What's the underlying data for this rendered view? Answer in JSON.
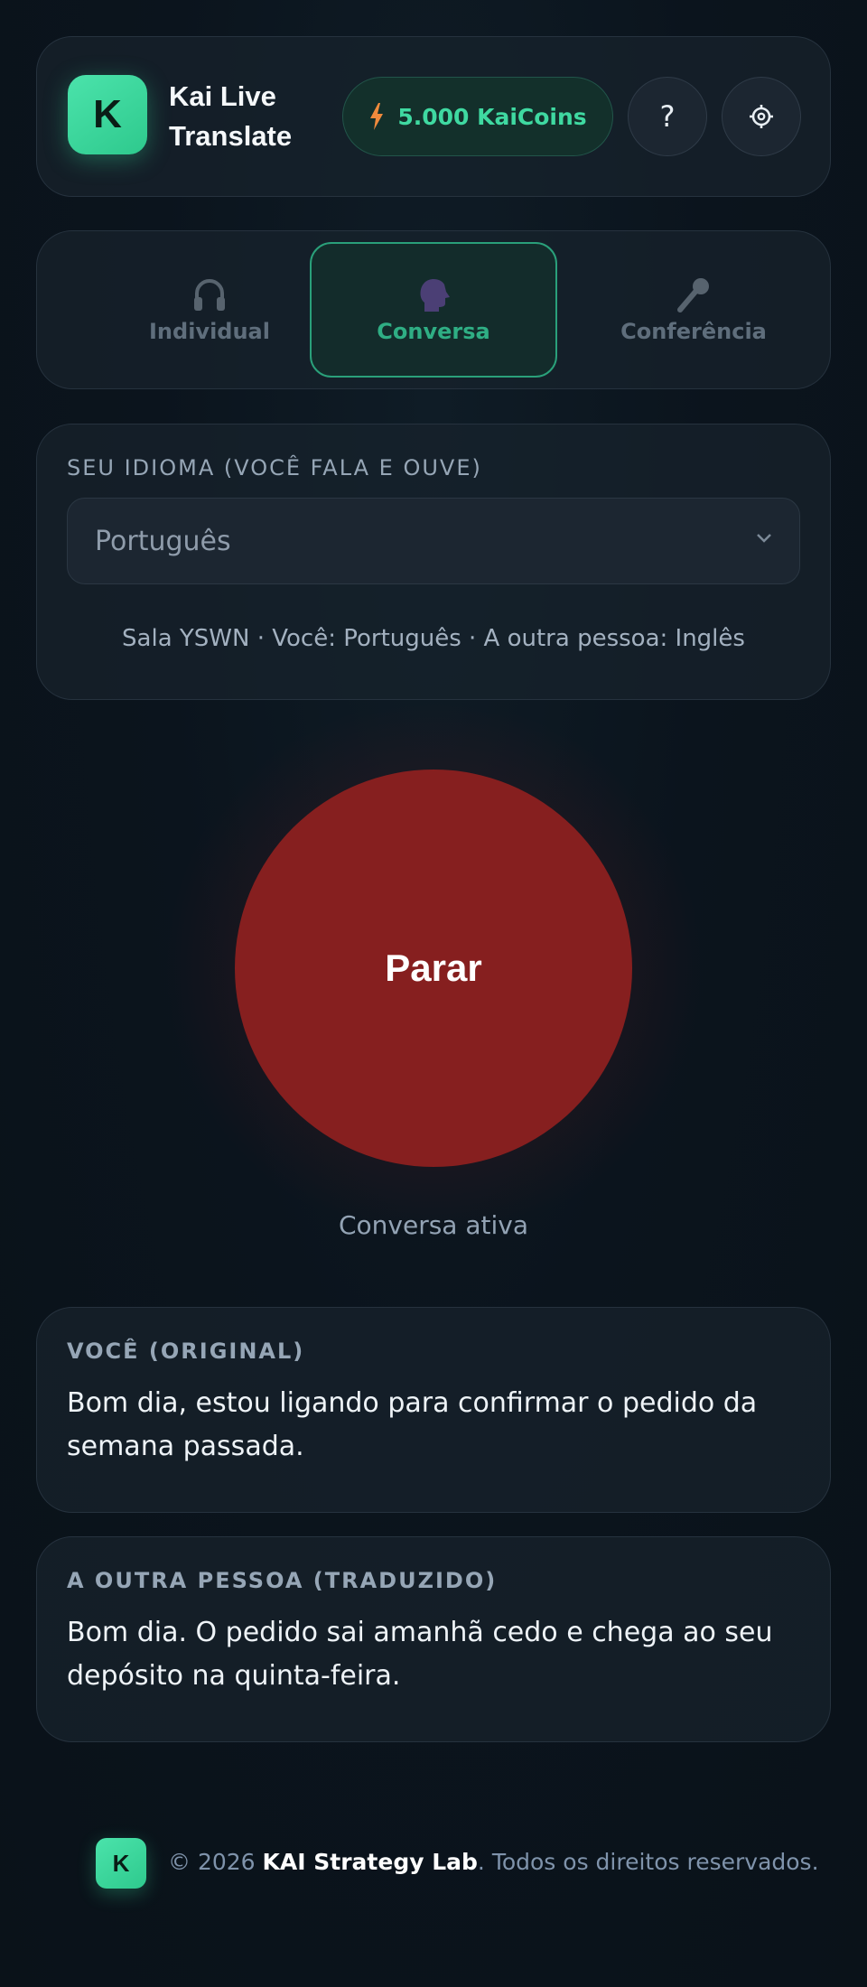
{
  "header": {
    "logo_letter": "K",
    "title": "Kai Live Translate",
    "coins_label": "5.000 KaiCoins",
    "help_label": "?",
    "icons": {
      "coins": "bolt-icon",
      "settings": "gear-icon"
    }
  },
  "modes": {
    "tabs": [
      {
        "label": "Individual",
        "icon": "headphones-icon",
        "active": false
      },
      {
        "label": "Conversa",
        "icon": "speaking-head-icon",
        "active": true
      },
      {
        "label": "Conferência",
        "icon": "microphone-icon",
        "active": false
      }
    ]
  },
  "language": {
    "label": "SEU IDIOMA (VOCÊ FALA E OUVE)",
    "selected": "Português",
    "room_info": "Sala YSWN · Você: Português · A outra pessoa: Inglês"
  },
  "control": {
    "stop_label": "Parar",
    "status": "Conversa ativa"
  },
  "transcripts": {
    "you": {
      "label": "VOCÊ (ORIGINAL)",
      "text": "Bom dia, estou ligando para confirmar o pedido da semana passada."
    },
    "other": {
      "label": "A OUTRA PESSOA (TRADUZIDO)",
      "text": "Bom dia. O pedido sai amanhã cedo e chega ao seu depósito na quinta-feira."
    }
  },
  "footer": {
    "logo_letter": "K",
    "copyright": "© 2026 ",
    "brand": "KAI Strategy Lab",
    "rights": ". Todos os direitos reservados."
  },
  "colors": {
    "accent": "#34d399",
    "stop": "#861f1f",
    "background": "#0b141d"
  }
}
